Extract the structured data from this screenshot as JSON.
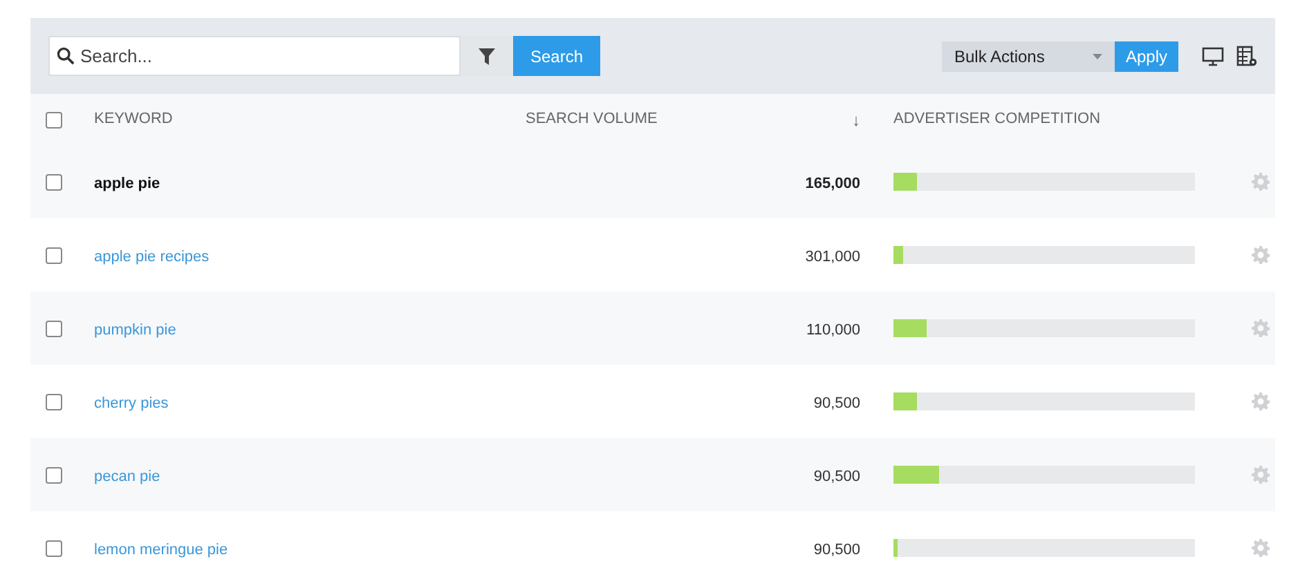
{
  "toolbar": {
    "search": {
      "placeholder": "Search..."
    },
    "search_button": "Search",
    "bulk_actions": {
      "value": "Bulk Actions"
    },
    "apply_button": "Apply"
  },
  "table": {
    "columns": [
      {
        "label": "KEYWORD"
      },
      {
        "label": "SEARCH VOLUME",
        "sort_indicator": "↓"
      },
      {
        "label": "ADVERTISER COMPETITION"
      }
    ],
    "header_checked": false,
    "rows": [
      {
        "kind": "seed",
        "keyword": "apple pie",
        "volume": "165,000",
        "level": 0.08,
        "checked": false
      },
      {
        "kind": "suggestion",
        "keyword": "apple pie recipes",
        "volume": "301,000",
        "level": 0.03,
        "checked": false
      },
      {
        "kind": "suggestion",
        "keyword": "pumpkin pie",
        "volume": "110,000",
        "level": 0.11,
        "checked": false
      },
      {
        "kind": "suggestion",
        "keyword": "cherry pies",
        "volume": "90,500",
        "level": 0.08,
        "checked": false
      },
      {
        "kind": "suggestion",
        "keyword": "pecan pie",
        "volume": "90,500",
        "level": 0.15,
        "checked": false
      },
      {
        "kind": "suggestion",
        "keyword": "lemon meringue pie",
        "volume": "90,500",
        "level": 0.015,
        "checked": false
      }
    ]
  }
}
